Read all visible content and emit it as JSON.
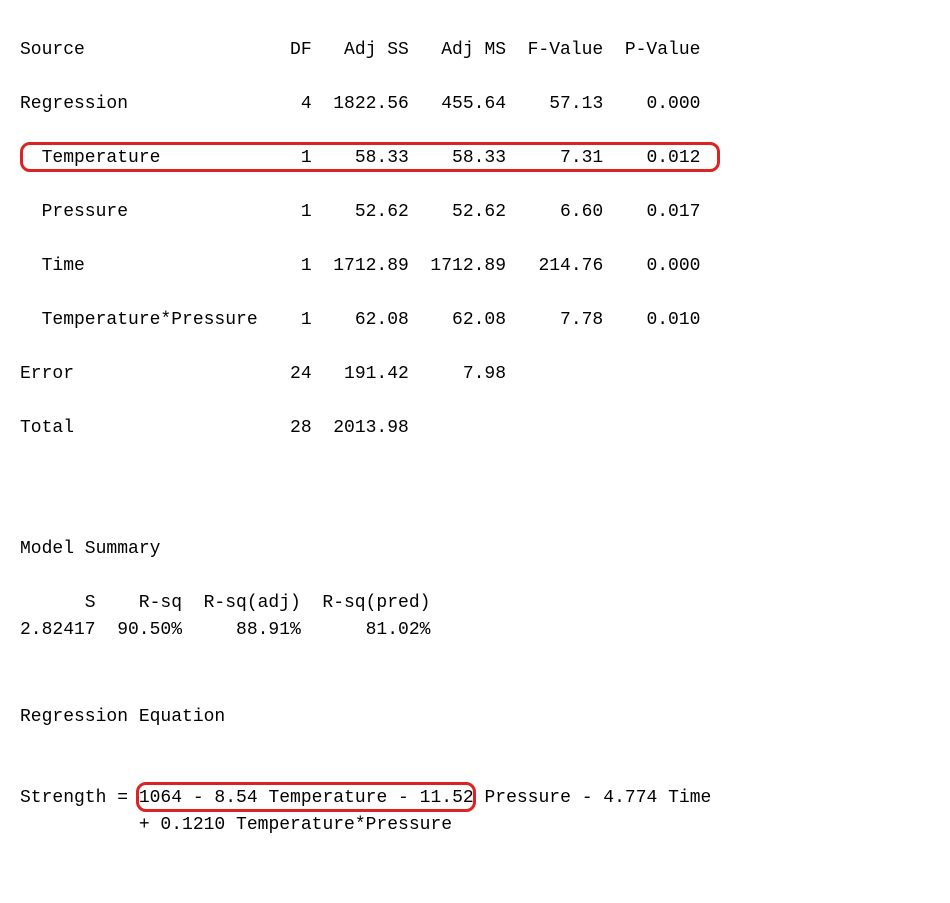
{
  "anova": {
    "headers": {
      "source": "Source",
      "df": "DF",
      "adjss": "Adj SS",
      "adjms": "Adj MS",
      "fvalue": "F-Value",
      "pvalue": "P-Value"
    },
    "rows": {
      "regression": {
        "source": "Regression",
        "df": "4",
        "adjss": "1822.56",
        "adjms": "455.64",
        "fvalue": "57.13",
        "pvalue": "0.000"
      },
      "temperature": {
        "source": "  Temperature",
        "df": "1",
        "adjss": "58.33",
        "adjms": "58.33",
        "fvalue": "7.31",
        "pvalue": "0.012"
      },
      "pressure": {
        "source": "  Pressure",
        "df": "1",
        "adjss": "52.62",
        "adjms": "52.62",
        "fvalue": "6.60",
        "pvalue": "0.017"
      },
      "time": {
        "source": "  Time",
        "df": "1",
        "adjss": "1712.89",
        "adjms": "1712.89",
        "fvalue": "214.76",
        "pvalue": "0.000"
      },
      "tempxpress": {
        "source": "  Temperature*Pressure",
        "df": "1",
        "adjss": "62.08",
        "adjms": "62.08",
        "fvalue": "7.78",
        "pvalue": "0.010"
      },
      "error": {
        "source": "Error",
        "df": "24",
        "adjss": "191.42",
        "adjms": "7.98",
        "fvalue": "",
        "pvalue": ""
      },
      "total": {
        "source": "Total",
        "df": "28",
        "adjss": "2013.98",
        "adjms": "",
        "fvalue": "",
        "pvalue": ""
      }
    }
  },
  "model_summary": {
    "title": "Model Summary",
    "headers": {
      "s": "S",
      "rsq": "R-sq",
      "rsqadj": "R-sq(adj)",
      "rsqpred": "R-sq(pred)"
    },
    "values": {
      "s": "2.82417",
      "rsq": "90.50%",
      "rsqadj": "88.91%",
      "rsqpred": "81.02%"
    }
  },
  "regression_equation": {
    "title": "Regression Equation",
    "line1": "Strength = 1064 - 8.54 Temperature - 11.52 Pressure - 4.774 Time",
    "line2": "           + 0.1210 Temperature*Pressure"
  }
}
